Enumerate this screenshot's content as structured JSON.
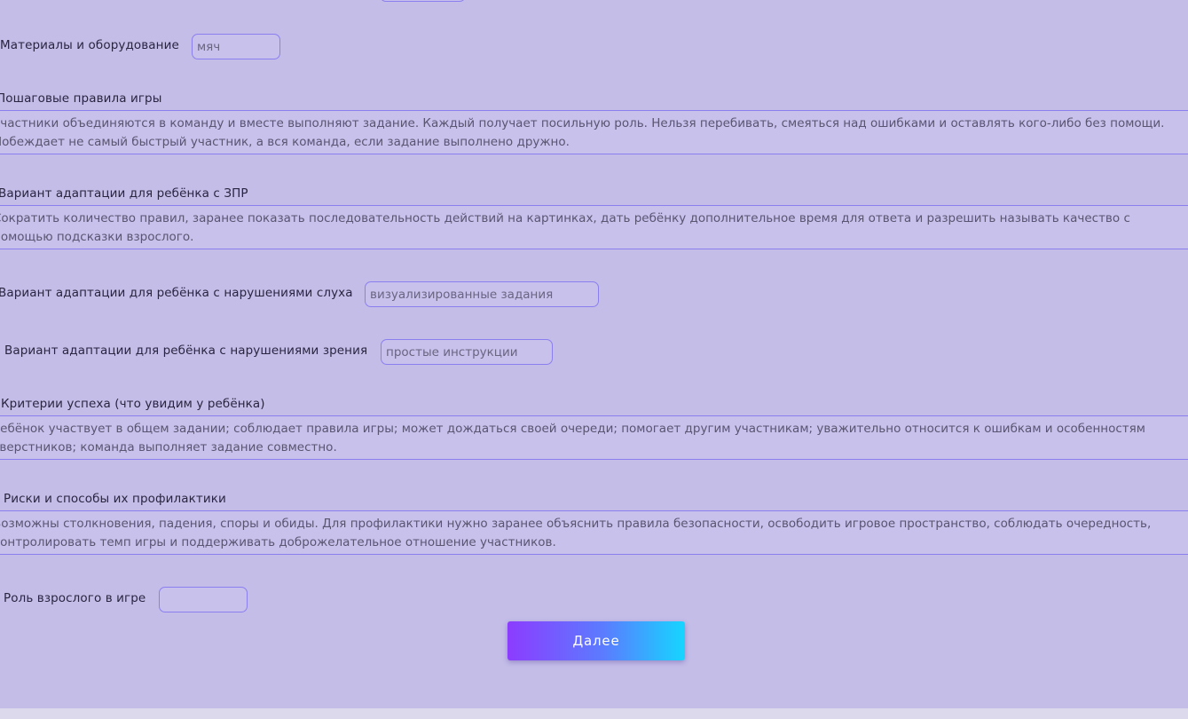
{
  "fields": {
    "materials": {
      "label": "Материалы и оборудование",
      "value": "мяч"
    },
    "rules": {
      "label": "Пошаговые правила игры",
      "lines": [
        "Участники объединяются в команду и вместе выполняют задание. Каждый получает посильную роль. Нельзя перебивать, смеяться над ошибками и оставлять кого-либо без помощи.",
        "Побеждает не самый быстрый участник, а вся команда, если задание выполнено дружно."
      ]
    },
    "zpr": {
      "label": "Вариант адаптации для ребёнка с ЗПР",
      "lines": [
        "Сократить количество правил, заранее показать последовательность действий на картинках, дать ребёнку дополнительное время для ответа и разрешить называть качество с",
        "помощью подсказки взрослого."
      ]
    },
    "hearing": {
      "label": "Вариант адаптации для ребёнка с нарушениями слуха",
      "value": "визуализированные задания"
    },
    "vision": {
      "label": "Вариант адаптации для ребёнка с нарушениями зрения",
      "value": "простые инструкции"
    },
    "success": {
      "label": "Критерии успеха (что увидим у ребёнка)",
      "lines": [
        "Ребёнок участвует в общем задании; соблюдает правила игры; может дождаться своей очереди; помогает другим участникам; уважительно относится к ошибкам и особенностям",
        "сверстников; команда выполняет задание совместно."
      ]
    },
    "risks": {
      "label": "Риски и способы их профилактики",
      "lines": [
        "Возможны столкновения, падения, споры и обиды. Для профилактики нужно заранее объяснить правила безопасности, освободить игровое пространство, соблюдать очередность,",
        "контролировать темп игры и поддерживать доброжелательное отношение участников."
      ]
    },
    "adult_role": {
      "label": "Роль взрослого в игре",
      "value": ""
    }
  },
  "buttons": {
    "next_label": "Далее"
  },
  "colors": {
    "page_background": "#c3bde8",
    "field_border": "#8b7ff0",
    "button_gradient_start": "#8c3cff",
    "button_gradient_end": "#15d6ff"
  }
}
